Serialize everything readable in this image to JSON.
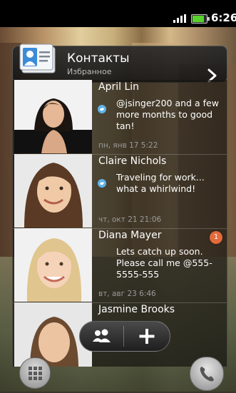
{
  "status_bar": {
    "time": "6:26"
  },
  "widget": {
    "title": "Контакты",
    "subtitle": "Избранное"
  },
  "contacts": [
    {
      "name": "April Lin",
      "message": "@jsinger200 and a few more months to good tan!",
      "timestamp": "пн, янв 17 5:22",
      "source_icon": "twitter-bird-icon"
    },
    {
      "name": "Claire Nichols",
      "message": "Traveling for work... what a whirlwind!",
      "timestamp": "чт, окт 21 21:06",
      "source_icon": "twitter-bird-icon"
    },
    {
      "name": "Diana Mayer",
      "message": "Lets catch up soon. Please call me @555-5555-555",
      "timestamp": "вт, авг 23 6:46",
      "badge": "1"
    },
    {
      "name": "Jasmine Brooks"
    }
  ],
  "colors": {
    "battery": "#57d32c",
    "badge": "#e26a3b",
    "twitter": "#5fb3e6"
  }
}
